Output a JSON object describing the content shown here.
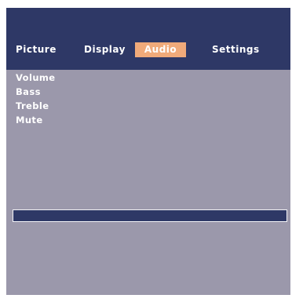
{
  "tabs": {
    "picture": "Picture",
    "display": "Display",
    "audio": "Audio",
    "settings": "Settings",
    "active": "Audio"
  },
  "audio_menu": {
    "items": [
      "Volume",
      "Bass",
      "Treble",
      "Mute"
    ]
  },
  "colors": {
    "header_bg": "#2e3866",
    "body_bg": "#9b98ab",
    "active_tab": "#f0aa7a",
    "text": "#ffffff"
  }
}
